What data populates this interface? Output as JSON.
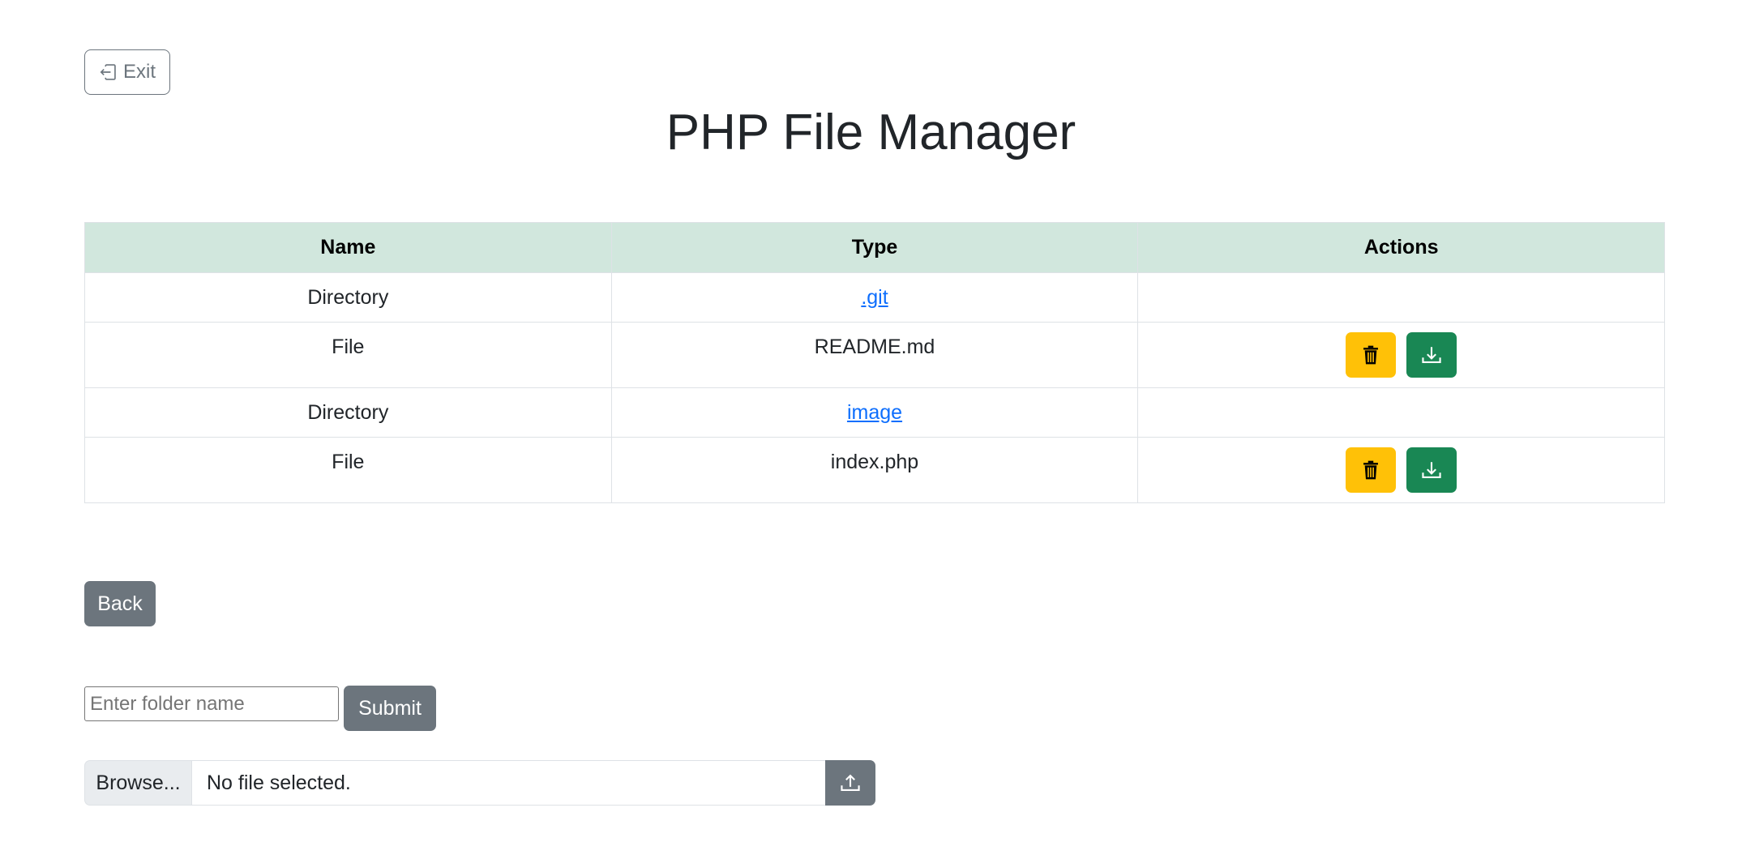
{
  "header": {
    "exit_label": "Exit",
    "title": "PHP File Manager"
  },
  "table": {
    "columns": [
      "Name",
      "Type",
      "Actions"
    ],
    "rows": [
      {
        "name": "Directory",
        "type": ".git",
        "is_link": true,
        "has_actions": false
      },
      {
        "name": "File",
        "type": "README.md",
        "is_link": false,
        "has_actions": true
      },
      {
        "name": "Directory",
        "type": "image",
        "is_link": true,
        "has_actions": false
      },
      {
        "name": "File",
        "type": "index.php",
        "is_link": false,
        "has_actions": true
      }
    ],
    "action_icons": {
      "delete": "trash-icon",
      "download": "download-icon"
    }
  },
  "back_label": "Back",
  "folder_form": {
    "placeholder": "Enter folder name",
    "value": "",
    "submit_label": "Submit"
  },
  "upload": {
    "browse_label": "Browse...",
    "status": "No file selected.",
    "icon": "upload-icon"
  },
  "colors": {
    "header_bg": "#d1e7dd",
    "warning": "#ffc107",
    "success": "#198754",
    "secondary": "#6c757d",
    "link": "#0d6efd"
  }
}
